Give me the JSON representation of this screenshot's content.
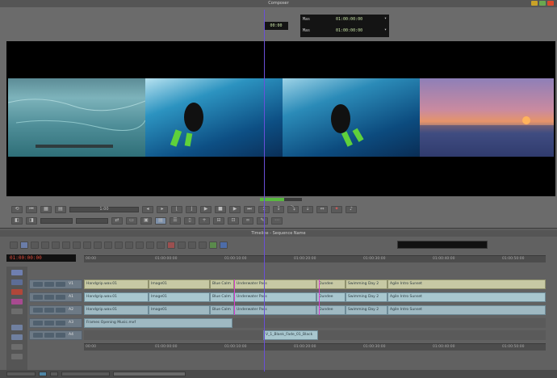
{
  "composer": {
    "title": "Composer",
    "center_tc": "00:00",
    "mark_in_label": "Mas",
    "mark_in_value": "01:00:00:00",
    "mark_out_label": "Mas",
    "mark_out_value": "01:00:00:00",
    "slider_value": "1:00",
    "colors": {
      "close": "#d94a2d",
      "min": "#c9a227",
      "max": "#6aa84f"
    }
  },
  "clips": [
    {
      "name": "underwater-ice-clip",
      "gradient": "linear-gradient(180deg,#5c8c96 0%,#7db3bb 25%,#4f8e98 60%,#2f6f78 100%)"
    },
    {
      "name": "diver-clip-1",
      "gradient": "linear-gradient(160deg,#b7e2f0 0%,#2c93c0 30%,#0d4f84 70%,#0a2f58 100%)"
    },
    {
      "name": "diver-clip-2",
      "gradient": "linear-gradient(160deg,#9ed3e7 0%,#2b8bb8 30%,#0c4b7e 70%,#0a2d55 100%)"
    },
    {
      "name": "sunset-clip",
      "gradient": "linear-gradient(180deg,#8e7fb8 0%,#c98aa0 40%,#e6946a 55%,#4d5a8e 70%,#2b3463 100%)"
    }
  ],
  "timeline": {
    "title": "Timeline - Sequence Name",
    "timecode": "01:00:00:00",
    "ruler_ticks": [
      "00:00",
      "01:00:00:00",
      "01:00:10:00",
      "01:00:20:00",
      "01:00:30:00",
      "01:00:40:00",
      "01:00:50:00"
    ],
    "tracks": [
      {
        "label": "V1",
        "segments": [
          "Handgrip.wav.01",
          "Image01",
          "Blue Calm",
          "Underwater Pass",
          "Dundee",
          "Swimming Day 2",
          "Agile Intro Sunset"
        ]
      },
      {
        "label": "A1",
        "segments": [
          "Handgrip.wav.01",
          "Image01",
          "Blue Calm",
          "Underwater Pass",
          "Dundee",
          "Swimming Day 2",
          "Agile Intro Sunset"
        ]
      },
      {
        "label": "A2",
        "segments": [
          "Handgrip.wav.01",
          "Image01",
          "Blue Calm",
          "Underwater Pass",
          "Dundee",
          "Swimming Day 2",
          "Agile Intro Sunset"
        ]
      },
      {
        "label": "A3",
        "segments": [
          "Frames Opening Music.mxf"
        ]
      },
      {
        "label": "A4",
        "segments": [
          "V_1_Blank_Fade_01_Black"
        ]
      }
    ]
  }
}
